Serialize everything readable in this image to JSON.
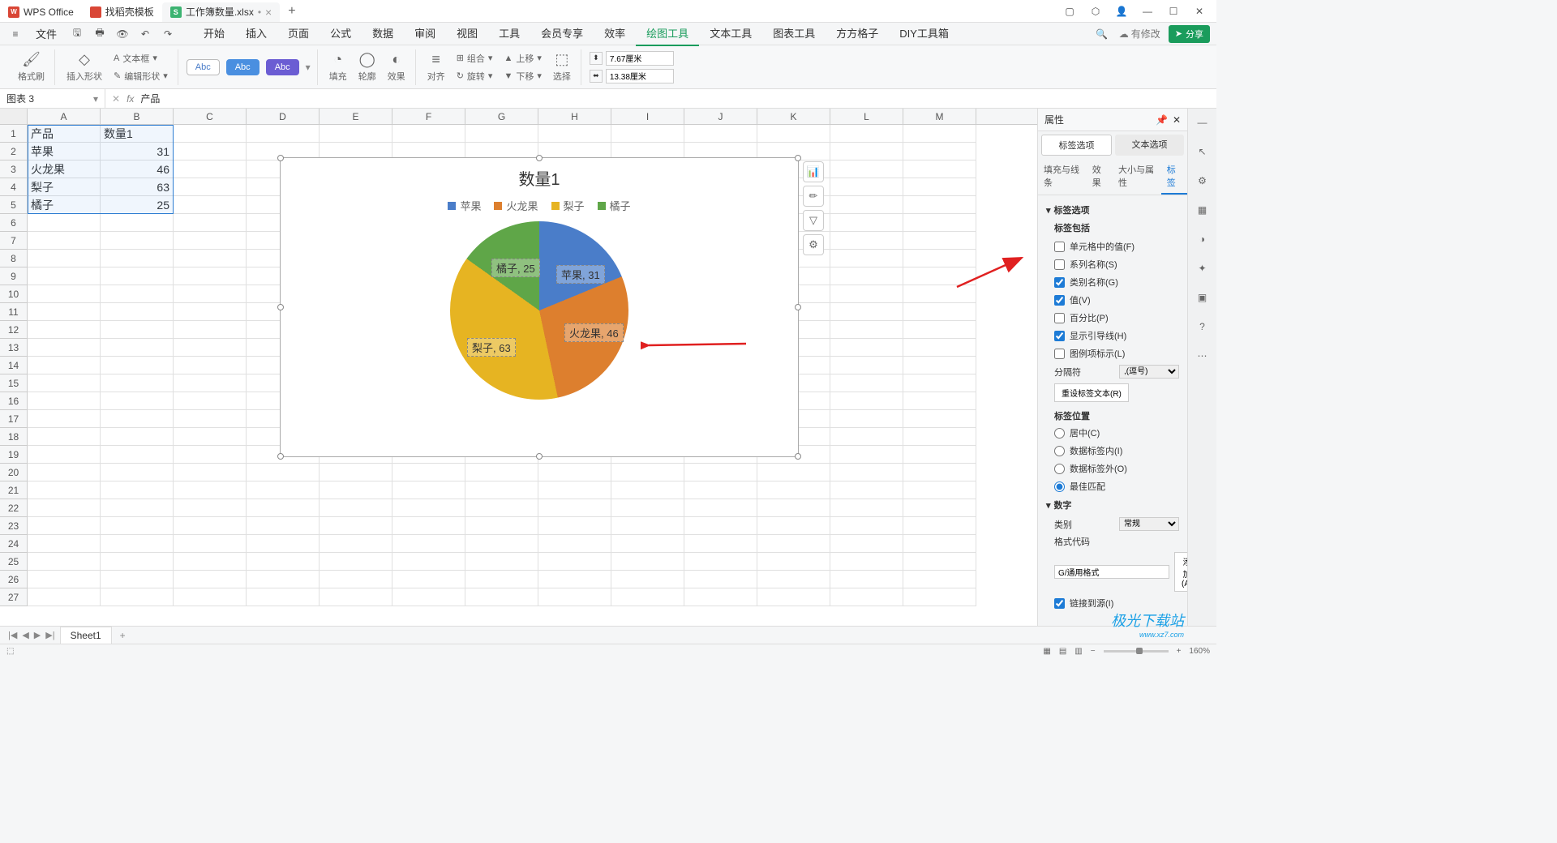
{
  "app": {
    "name": "WPS Office"
  },
  "title_tabs": [
    {
      "icon": "wps",
      "label": "WPS Office"
    },
    {
      "icon": "t",
      "label": "找稻壳模板"
    },
    {
      "icon": "s",
      "label": "工作簿数量.xlsx",
      "active": true
    }
  ],
  "menubar": {
    "file": "文件",
    "tabs": [
      "开始",
      "插入",
      "页面",
      "公式",
      "数据",
      "审阅",
      "视图",
      "工具",
      "会员专享",
      "效率",
      "绘图工具",
      "文本工具",
      "图表工具",
      "方方格子",
      "DIY工具箱"
    ],
    "active_tab": "绘图工具",
    "undo_count": "",
    "has_changes": "有修改",
    "share": "分享"
  },
  "ribbon": {
    "format_painter": "格式刷",
    "insert_shape": "插入形状",
    "edit_shape": "编辑形状",
    "text_box": "文本框",
    "abc": "Abc",
    "fill": "填充",
    "outline": "轮廓",
    "effect": "效果",
    "align": "对齐",
    "group": "组合",
    "rotate": "旋转",
    "move_up": "上移",
    "move_down": "下移",
    "select": "选择",
    "w": "7.67厘米",
    "h": "13.38厘米"
  },
  "name_box": "图表 3",
  "formula": "产品",
  "fx": "fx",
  "columns": [
    "A",
    "B",
    "C",
    "D",
    "E",
    "F",
    "G",
    "H",
    "I",
    "J",
    "K",
    "L",
    "M"
  ],
  "row_count": 27,
  "table": {
    "headers": [
      "产品",
      "数量1"
    ],
    "rows": [
      [
        "苹果",
        "31"
      ],
      [
        "火龙果",
        "46"
      ],
      [
        "梨子",
        "63"
      ],
      [
        "橘子",
        "25"
      ]
    ]
  },
  "chart_data": {
    "type": "pie",
    "title": "数量1",
    "categories": [
      "苹果",
      "火龙果",
      "梨子",
      "橘子"
    ],
    "values": [
      31,
      46,
      63,
      25
    ],
    "colors": [
      "#4a7dc9",
      "#dd7f2e",
      "#e6b422",
      "#5fa648"
    ],
    "labels": [
      "苹果, 31",
      "火龙果, 46",
      "梨子, 63",
      "橘子, 25"
    ]
  },
  "chart_side_btns": [
    "chart-type",
    "edit",
    "filter",
    "settings"
  ],
  "right_panel": {
    "header": "属性",
    "tab1": "标签选项",
    "tab2": "文本选项",
    "subtabs": [
      "填充与线条",
      "效果",
      "大小与属性",
      "标签"
    ],
    "active_subtab": "标签",
    "sec_label_opts": "标签选项",
    "sec_label_incl": "标签包括",
    "cb_cell_value": "单元格中的值(F)",
    "cb_series": "系列名称(S)",
    "cb_category": "类别名称(G)",
    "cb_value": "值(V)",
    "cb_percent": "百分比(P)",
    "cb_leader": "显示引导线(H)",
    "cb_legend_key": "图例项标示(L)",
    "separator": "分隔符",
    "separator_val": ",(逗号)",
    "reset_label": "重设标签文本(R)",
    "sec_label_pos": "标签位置",
    "rb_center": "居中(C)",
    "rb_inside": "数据标签内(I)",
    "rb_outside": "数据标签外(O)",
    "rb_best": "最佳匹配",
    "sec_number": "数字",
    "cat_label": "类别",
    "cat_val": "常规",
    "code_label": "格式代码",
    "code_val": "G/通用格式",
    "add_btn": "添加(A)",
    "link_source": "链接到源(I)"
  },
  "sheet_tabs": {
    "active": "Sheet1"
  },
  "status": {
    "zoom": "160%"
  },
  "watermark": {
    "t1": "极光下载站",
    "t2": "www.xz7.com"
  }
}
